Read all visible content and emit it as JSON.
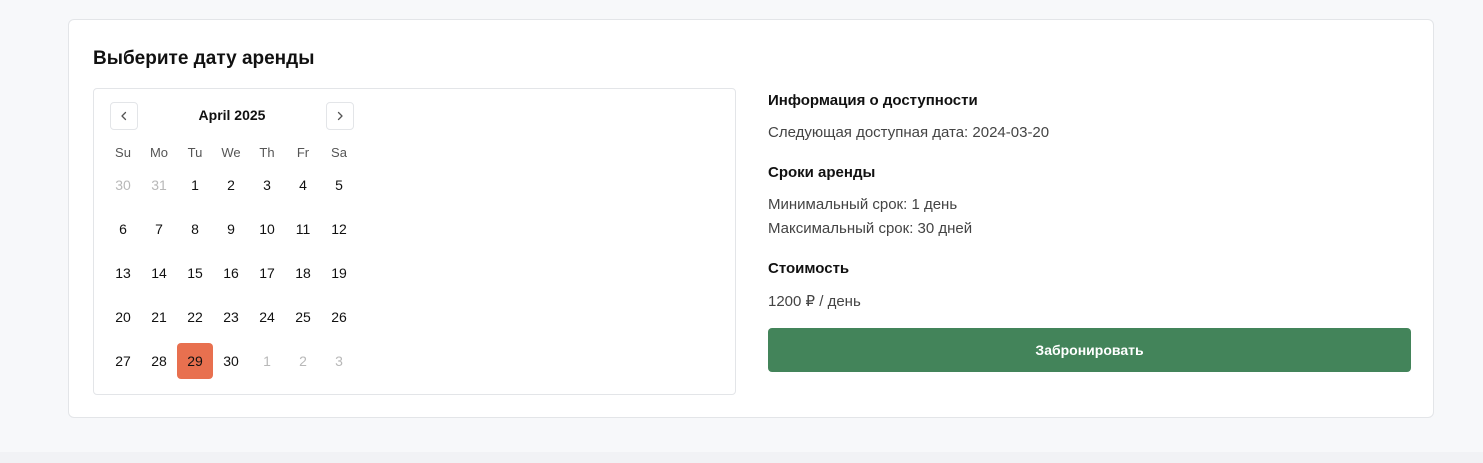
{
  "title": "Выберите дату аренды",
  "calendar": {
    "month_label": "April 2025",
    "prev_icon": "chevron-left-icon",
    "next_icon": "chevron-right-icon",
    "weekdays": [
      "Su",
      "Mo",
      "Tu",
      "We",
      "Th",
      "Fr",
      "Sa"
    ],
    "days": [
      {
        "label": "30",
        "outside": true
      },
      {
        "label": "31",
        "outside": true
      },
      {
        "label": "1"
      },
      {
        "label": "2"
      },
      {
        "label": "3"
      },
      {
        "label": "4"
      },
      {
        "label": "5"
      },
      {
        "label": "6"
      },
      {
        "label": "7"
      },
      {
        "label": "8"
      },
      {
        "label": "9"
      },
      {
        "label": "10"
      },
      {
        "label": "11"
      },
      {
        "label": "12"
      },
      {
        "label": "13"
      },
      {
        "label": "14"
      },
      {
        "label": "15"
      },
      {
        "label": "16"
      },
      {
        "label": "17"
      },
      {
        "label": "18"
      },
      {
        "label": "19"
      },
      {
        "label": "20"
      },
      {
        "label": "21"
      },
      {
        "label": "22"
      },
      {
        "label": "23"
      },
      {
        "label": "24"
      },
      {
        "label": "25"
      },
      {
        "label": "26"
      },
      {
        "label": "27"
      },
      {
        "label": "28"
      },
      {
        "label": "29",
        "selected": true
      },
      {
        "label": "30"
      },
      {
        "label": "1",
        "outside": true
      },
      {
        "label": "2",
        "outside": true
      },
      {
        "label": "3",
        "outside": true
      }
    ],
    "selected_color": "#e8704f"
  },
  "info": {
    "availability_heading": "Информация о доступности",
    "next_available": "Следующая доступная дата: 2024-03-20",
    "terms_heading": "Сроки аренды",
    "min_term": "Минимальный срок: 1 день",
    "max_term": "Максимальный срок: 30 дней",
    "price_heading": "Стоимость",
    "price": "1200 ₽ / день",
    "book_button": "Забронировать",
    "button_color": "#43845a"
  }
}
